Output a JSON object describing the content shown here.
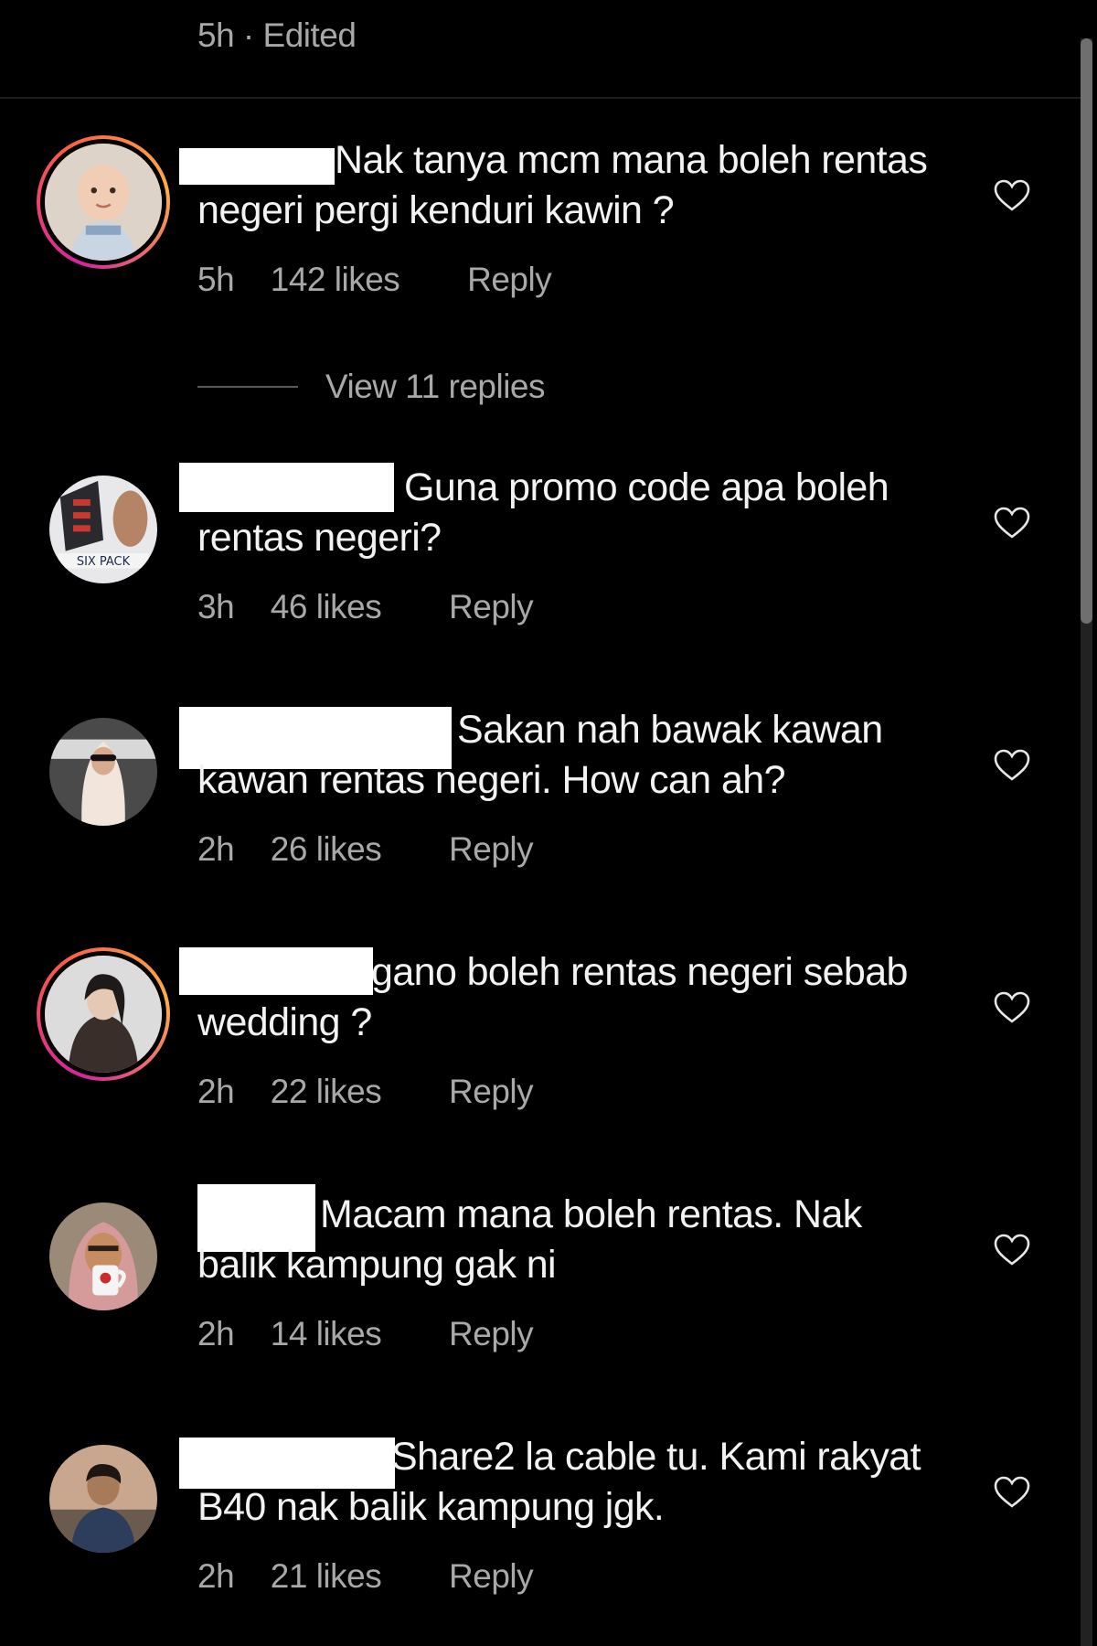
{
  "header": {
    "meta": "5h · Edited"
  },
  "comments": [
    {
      "text": "Nak tanya mcm mana boleh rentas negeri pergi kenduri kawin ?",
      "time": "5h",
      "likes": "142 likes",
      "reply": "Reply",
      "story_ring": true,
      "avatar_icon": "baby-avatar"
    },
    {
      "text": "Guna promo code apa boleh rentas negeri?",
      "time": "3h",
      "likes": "46 likes",
      "reply": "Reply",
      "story_ring": false,
      "avatar_icon": "six-pack-logo-avatar",
      "avatar_text": "SIX PACK"
    },
    {
      "text": "Sakan nah bawak kawan kawan rentas negeri. How can ah?",
      "time": "2h",
      "likes": "26 likes",
      "reply": "Reply",
      "story_ring": false,
      "avatar_icon": "hijab-woman-avatar"
    },
    {
      "text": "gano boleh rentas negeri sebab wedding ?",
      "time": "2h",
      "likes": "22 likes",
      "reply": "Reply",
      "story_ring": true,
      "avatar_icon": "woman-dark-avatar"
    },
    {
      "text": "Macam mana boleh rentas. Nak balik kampung gak ni",
      "time": "2h",
      "likes": "14 likes",
      "reply": "Reply",
      "story_ring": false,
      "avatar_icon": "woman-mug-avatar"
    },
    {
      "text": "Share2 la cable tu. Kami rakyat B40 nak balik kampung jgk.",
      "time": "2h",
      "likes": "21 likes",
      "reply": "Reply",
      "story_ring": false,
      "avatar_icon": "man-avatar"
    }
  ],
  "view_replies": {
    "label": "View 11 replies"
  },
  "colors": {
    "background": "#000000",
    "text": "#f2f2f2",
    "muted": "#a8a8a8"
  }
}
